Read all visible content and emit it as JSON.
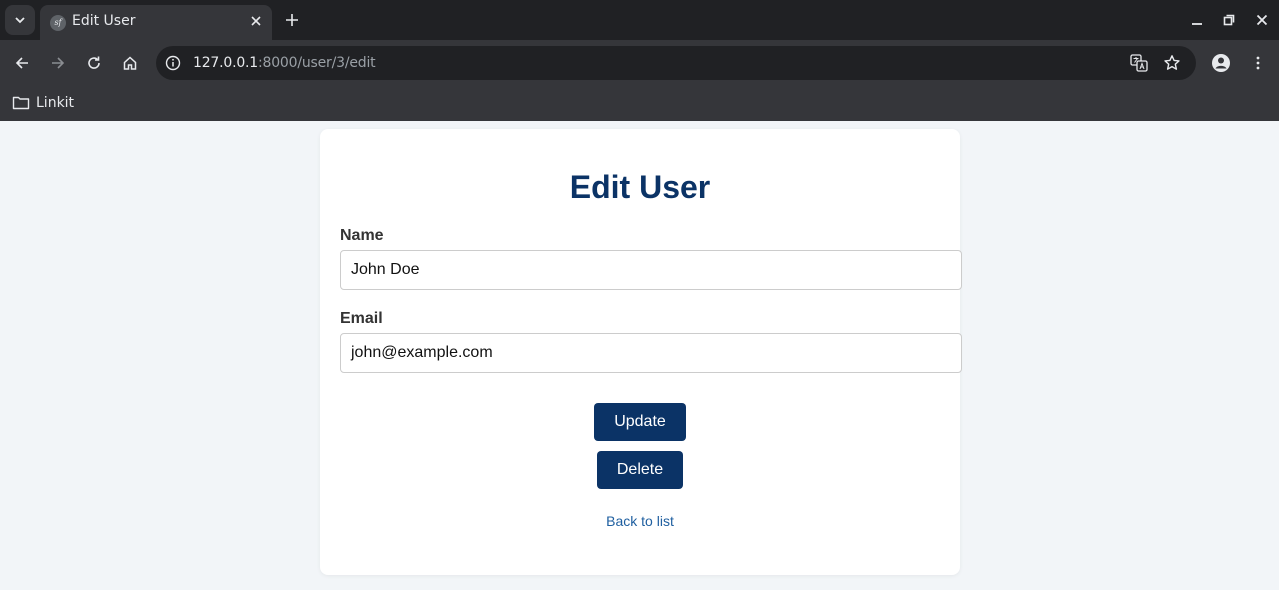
{
  "browser": {
    "tab_title": "Edit User",
    "favicon_text": "sf",
    "url_host": "127.0.0.1",
    "url_path": ":8000/user/3/edit",
    "bookmark_label": "Linkit"
  },
  "page": {
    "title": "Edit User",
    "name_label": "Name",
    "name_value": "John Doe",
    "email_label": "Email",
    "email_value": "john@example.com",
    "update_label": "Update",
    "delete_label": "Delete",
    "back_label": "Back to list"
  },
  "colors": {
    "primary": "#0b3366",
    "link": "#1f5fa0",
    "background": "#f2f5f8"
  }
}
